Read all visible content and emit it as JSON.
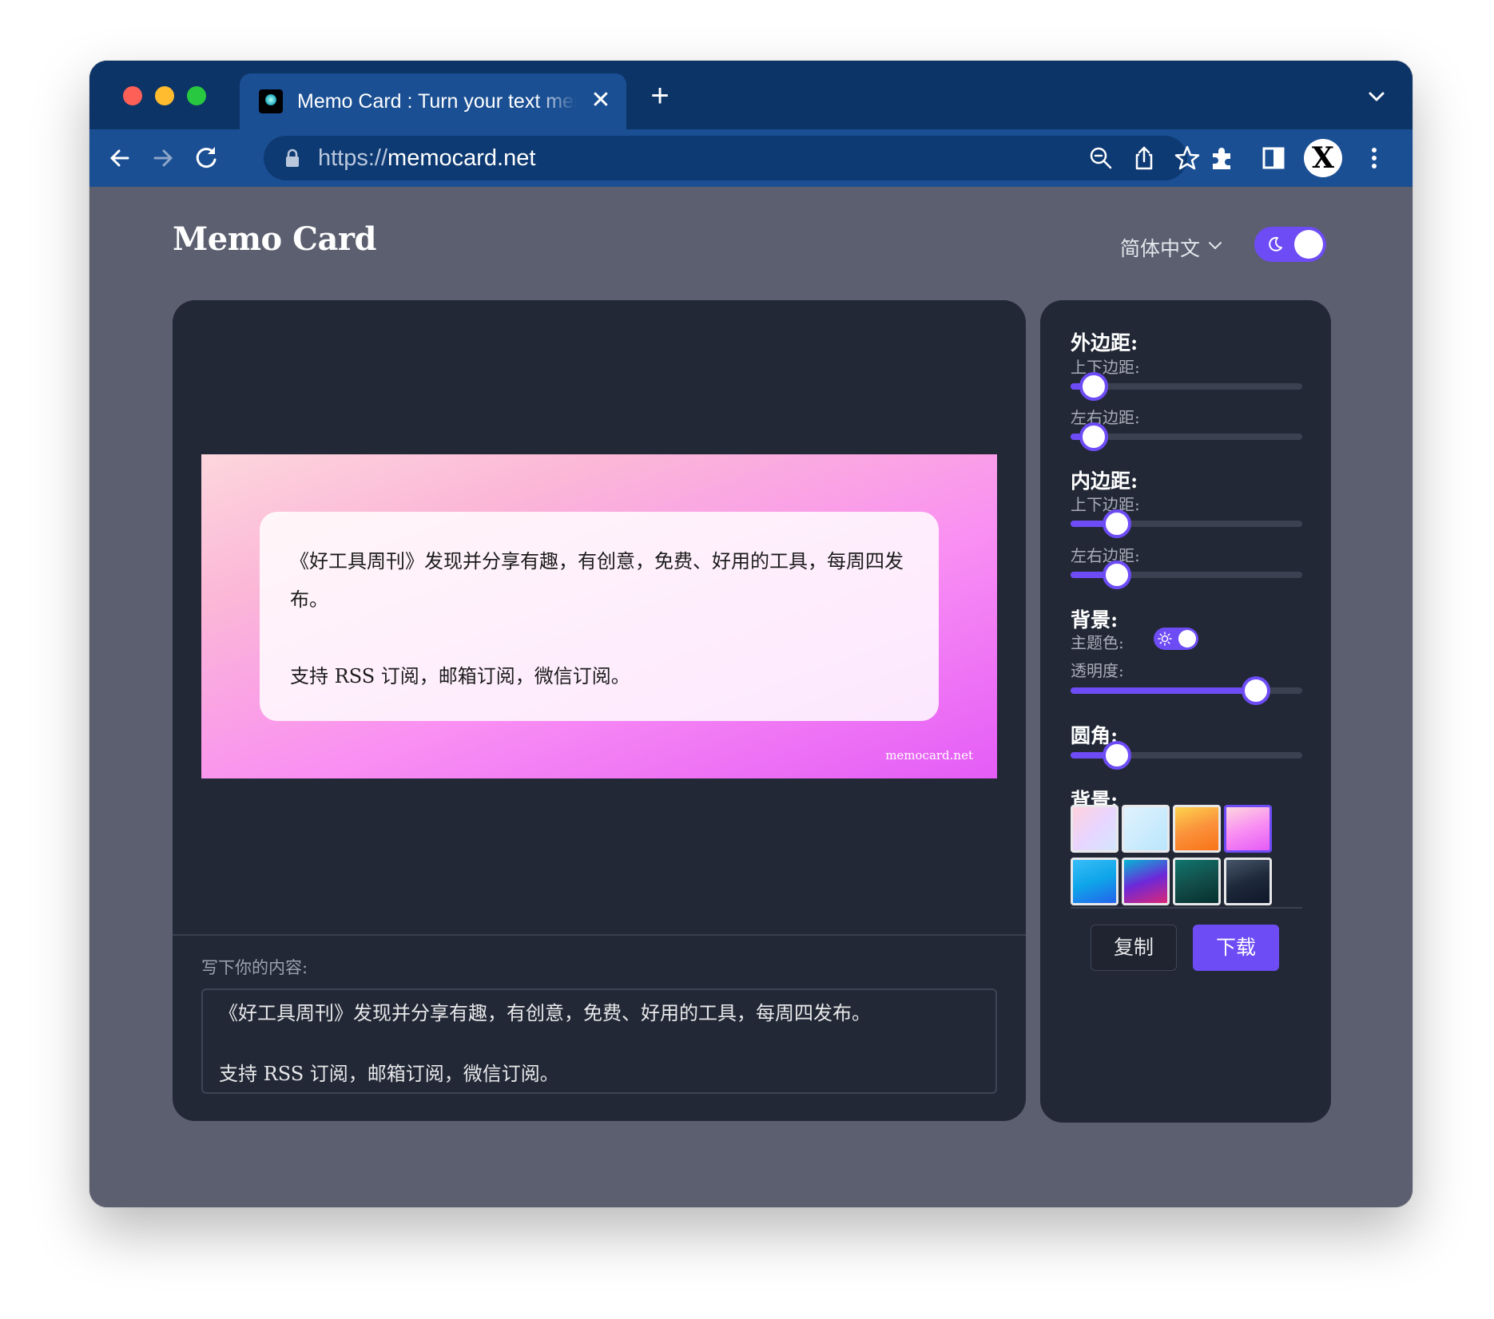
{
  "browser": {
    "tab_title": "Memo Card : Turn your text memo into beautiful card",
    "tab_close": "✕",
    "new_tab": "+",
    "url_protocol": "https://",
    "url_host": "memocard.net",
    "profile_letter": "X"
  },
  "header": {
    "brand": "Memo Card",
    "language": "简体中文"
  },
  "preview": {
    "paragraphs": [
      "《好工具周刊》发现并分享有趣，有创意，免费、好用的工具，每周四发布。",
      "支持 RSS 订阅，邮箱订阅，微信订阅。"
    ],
    "watermark": "memocard.net"
  },
  "editor": {
    "label": "写下你的内容:",
    "lines": [
      "《好工具周刊》发现并分享有趣，有创意，免费、好用的工具，每周四发布。",
      "支持 RSS 订阅，邮箱订阅，微信订阅。"
    ]
  },
  "settings": {
    "margin_title": "外边距:",
    "margin_vertical_label": "上下边距:",
    "margin_vertical_value": 0.1,
    "margin_horizontal_label": "左右边距:",
    "margin_horizontal_value": 0.1,
    "padding_title": "内边距:",
    "padding_vertical_label": "上下边距:",
    "padding_vertical_value": 0.2,
    "padding_horizontal_label": "左右边距:",
    "padding_horizontal_value": 0.2,
    "background_title": "背景:",
    "theme_color_label": "主题色:",
    "opacity_label": "透明度:",
    "opacity_value": 0.8,
    "radius_title": "圆角:",
    "radius_value": 0.2,
    "background_presets_title": "背景:",
    "presets": [
      {
        "name": "pastel-rainbow",
        "gradient": "linear-gradient(135deg,#ffd1dc,#e9d5ff,#d4e7ff)"
      },
      {
        "name": "sky-blue",
        "gradient": "linear-gradient(135deg,#e0f2fe,#bae6fd)"
      },
      {
        "name": "orange-sunset",
        "gradient": "linear-gradient(160deg,#fcd34d,#fb923c,#f97316)"
      },
      {
        "name": "pink-purple",
        "gradient": "linear-gradient(160deg,#fdd6dd,#f98ef3,#e45cf6)"
      },
      {
        "name": "ocean-blue",
        "gradient": "linear-gradient(160deg,#38bdf8,#0ea5e9,#2563eb)"
      },
      {
        "name": "neon-violet",
        "gradient": "linear-gradient(160deg,#06b6d4,#6d28d9,#db2777)"
      },
      {
        "name": "dark-teal",
        "gradient": "linear-gradient(160deg,#0f766e,#134e4a,#042f2e)"
      },
      {
        "name": "night-navy",
        "gradient": "linear-gradient(160deg,#475569,#1e293b,#0f172a)"
      }
    ],
    "selected_preset": 3,
    "copy_label": "复制",
    "download_label": "下载"
  },
  "colors": {
    "accent": "#6e4cf5",
    "tab_bar": "#0d3467",
    "toolbar": "#1a4f93",
    "panel": "#222836",
    "page_bg": "#5b5f6f"
  }
}
